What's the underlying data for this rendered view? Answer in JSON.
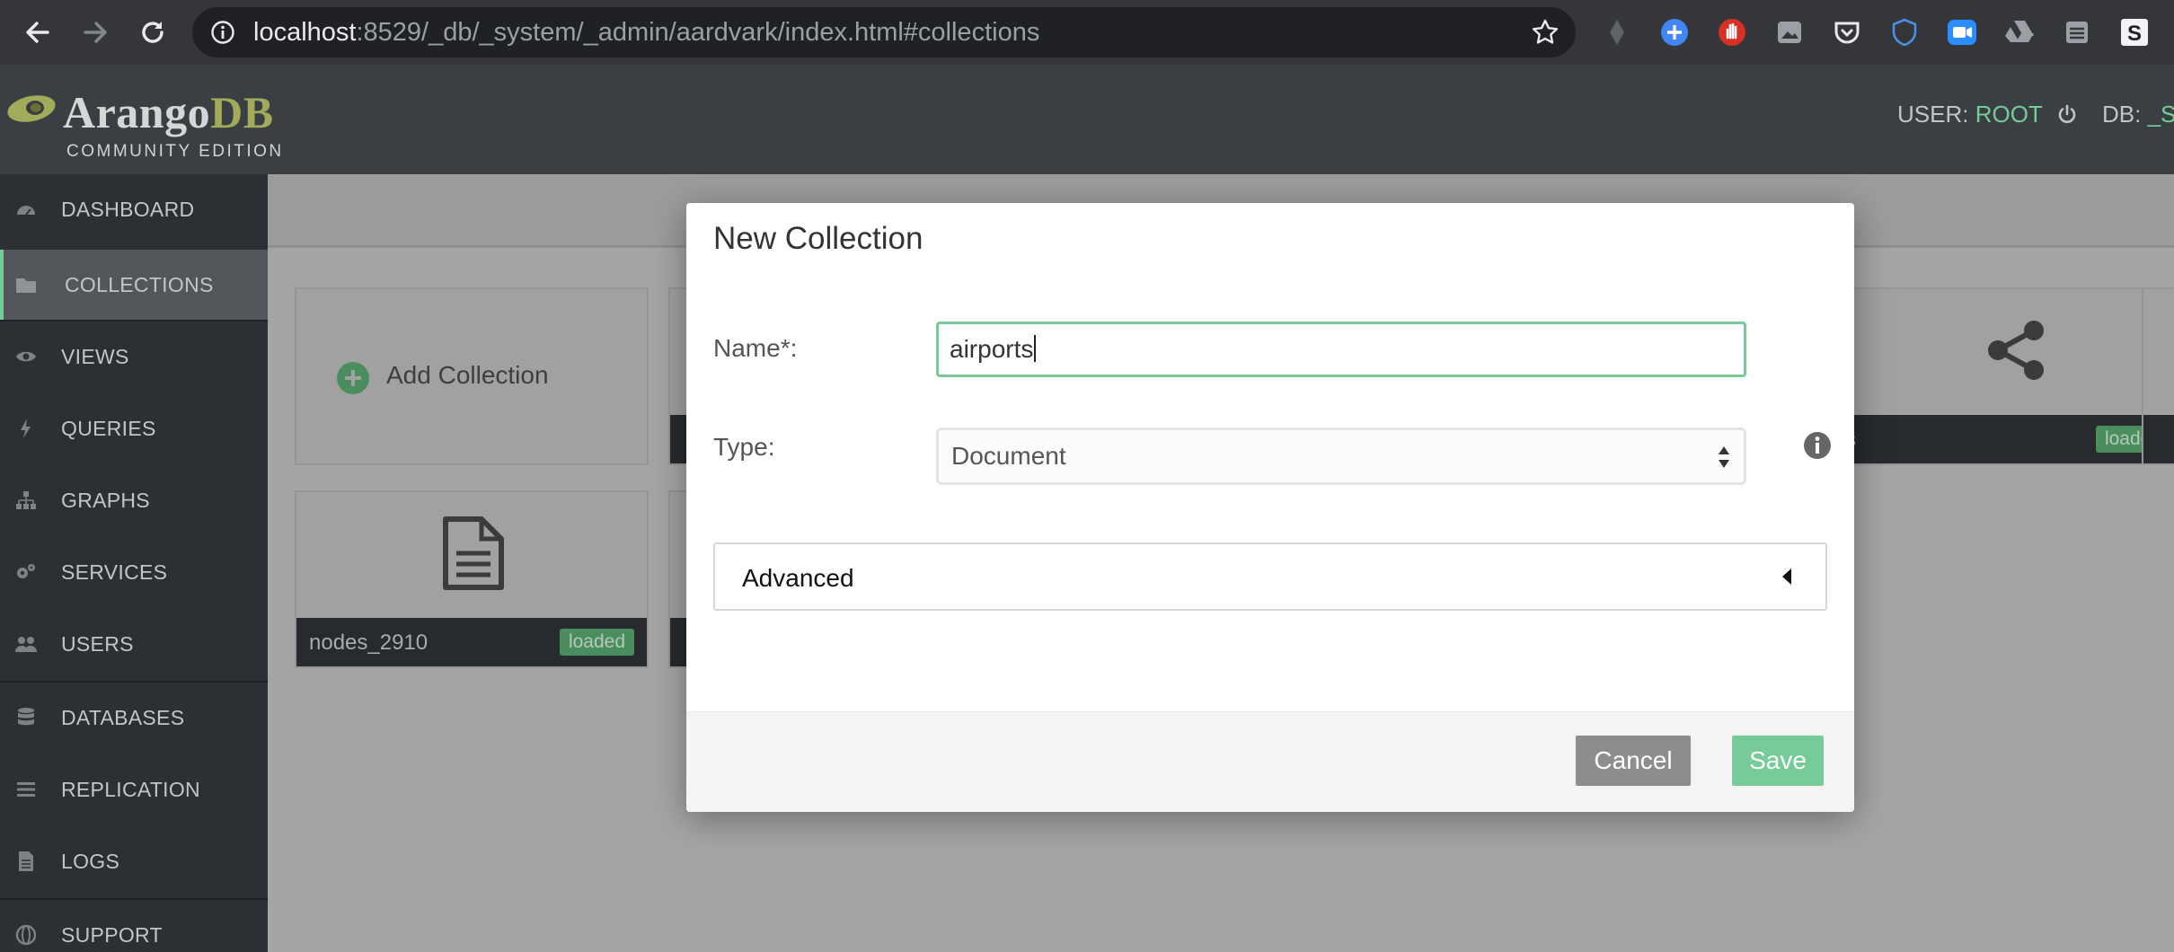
{
  "browser": {
    "url_host": "localhost",
    "url_rest": ":8529/_db/_system/_admin/aardvark/index.html#collections"
  },
  "header": {
    "logo_part1": "Arango",
    "logo_part2": "DB",
    "edition": "COMMUNITY EDITION",
    "user_label": "USER: ",
    "user_value": "ROOT",
    "db_label": "DB: ",
    "db_value": "_SY"
  },
  "sidebar": {
    "items": [
      {
        "label": "DASHBOARD",
        "icon": "dashboard-icon"
      },
      {
        "label": "COLLECTIONS",
        "icon": "folder-icon"
      },
      {
        "label": "VIEWS",
        "icon": "eye-icon"
      },
      {
        "label": "QUERIES",
        "icon": "bolt-icon"
      },
      {
        "label": "GRAPHS",
        "icon": "sitemap-icon"
      },
      {
        "label": "SERVICES",
        "icon": "cogs-icon"
      },
      {
        "label": "USERS",
        "icon": "users-icon"
      },
      {
        "label": "DATABASES",
        "icon": "database-icon"
      },
      {
        "label": "REPLICATION",
        "icon": "list-icon"
      },
      {
        "label": "LOGS",
        "icon": "file-icon"
      },
      {
        "label": "SUPPORT",
        "icon": "globe-icon"
      }
    ]
  },
  "collections": {
    "add_label": "Add Collection",
    "tiles": [
      {
        "name": "nodes_2910",
        "status": "loaded"
      },
      {
        "name": "s",
        "status": "loaded"
      }
    ]
  },
  "modal": {
    "title": "New Collection",
    "name_label": "Name*:",
    "name_value": "airports",
    "type_label": "Type:",
    "type_value": "Document",
    "advanced_label": "Advanced",
    "cancel_label": "Cancel",
    "save_label": "Save"
  },
  "colors": {
    "accent_green": "#77cb99",
    "sidebar_bg": "#2c3035",
    "header_bg": "#3a3f44"
  }
}
